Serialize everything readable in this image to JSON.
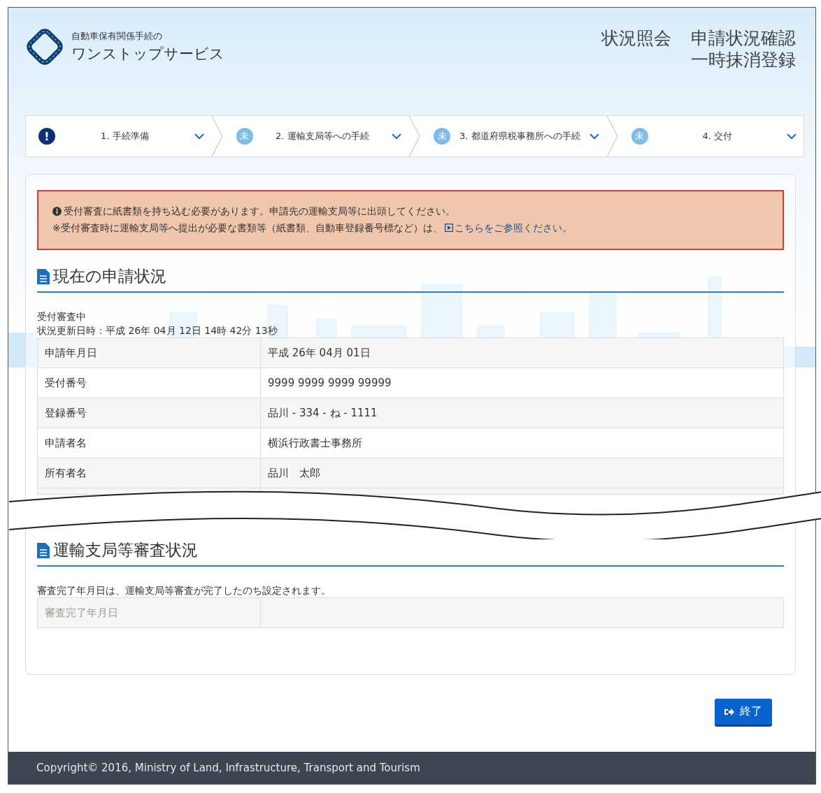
{
  "header": {
    "logo_line1": "自動車保有関係手続の",
    "logo_line2": "ワンストップサービス",
    "title_left": "状況照会",
    "title_right_lines": [
      "申請状況確認",
      "一時抹消登録"
    ]
  },
  "steps": [
    {
      "kind": "alert",
      "badge": "!",
      "label": "1. 手続準備"
    },
    {
      "kind": "pending",
      "badge": "未",
      "label": "2. 運輸支局等への手続"
    },
    {
      "kind": "pending",
      "badge": "未",
      "label": "3. 都道府県税事務所への手続"
    },
    {
      "kind": "pending",
      "badge": "未",
      "label": "4. 交付"
    }
  ],
  "alert": {
    "line1": "受付審査に紙書類を持ち込む必要があります。申請先の運輸支局等に出頭してください。",
    "line2": "※受付審査時に運輸支局等へ提出が必要な書類等（紙書類、自動車登録番号標など）は、",
    "link": "こちらをご参照ください。"
  },
  "current_status": {
    "heading": "現在の申請状況",
    "status": "受付審査中",
    "updated": "状況更新日時：平成 26年 04月 12日 14時 42分 13秒",
    "rows": [
      {
        "label": "申請年月日",
        "value": "平成 26年 04月 01日"
      },
      {
        "label": "受付番号",
        "value": "9999 9999 9999 99999"
      },
      {
        "label": "登録番号",
        "value": "品川 - 334 - ね - 1111"
      },
      {
        "label": "申請者名",
        "value": "横浜行政書士事務所"
      },
      {
        "label": "所有者名",
        "value": "品川　太郎"
      }
    ]
  },
  "review_status": {
    "heading": "運輸支局等審査状況",
    "note": "審査完了年月日は、運輸支局等審査が完了したのち設定されます。",
    "rows": [
      {
        "label": "審査完了年月日",
        "disabled": true
      }
    ]
  },
  "end_button": "終了",
  "footer": "Copyright© 2016, Ministry of Land, Infrastructure, Transport and Tourism"
}
